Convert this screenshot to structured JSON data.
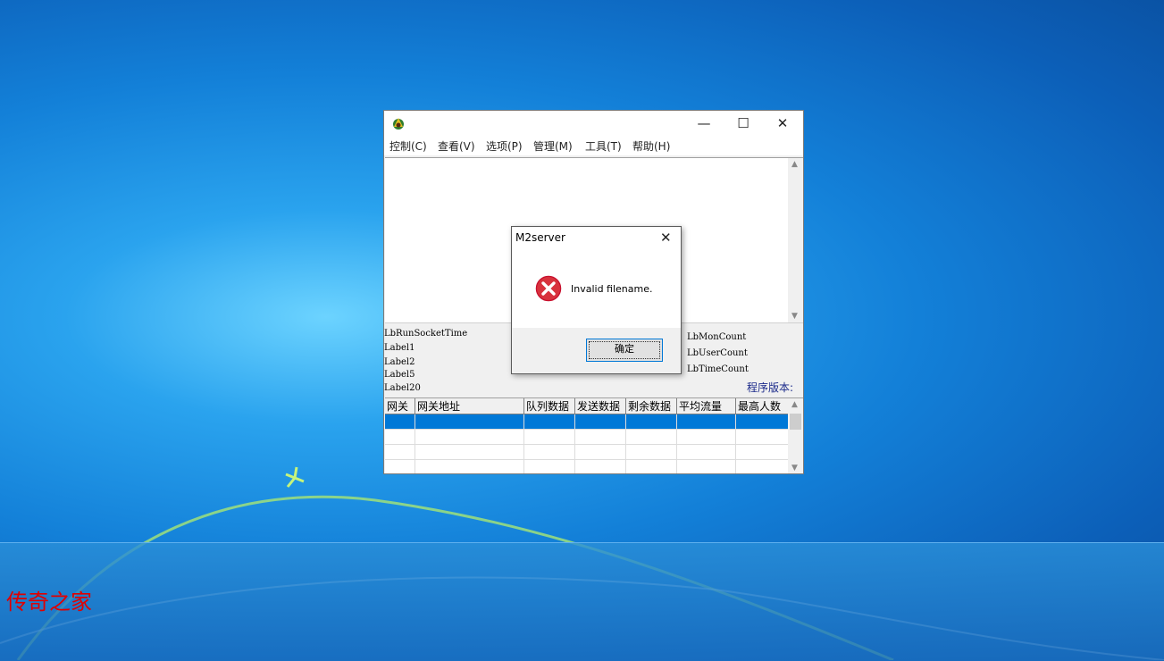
{
  "brand_text": "传奇之家",
  "app": {
    "title": "",
    "icon": "app-icon",
    "window_controls": {
      "minimize": "—",
      "maximize": "☐",
      "close": "✕"
    },
    "menu": [
      {
        "label": "控制(C)"
      },
      {
        "label": "查看(V)"
      },
      {
        "label": "选项(P)"
      },
      {
        "label": "管理(M)"
      },
      {
        "label": "工具(T)"
      },
      {
        "label": "帮助(H)"
      }
    ],
    "status_labels_left": [
      "LbRunSocketTime",
      "Label1",
      "Label2",
      "Label5",
      "Label20"
    ],
    "status_labels_right": [
      "LbMonCount",
      "LbUserCount",
      "LbTimeCount"
    ],
    "version_label": "程序版本:",
    "grid": {
      "columns": [
        "网关",
        "网关地址",
        "队列数据",
        "发送数据",
        "剩余数据",
        "平均流量",
        "最高人数"
      ],
      "selected_row": 0
    }
  },
  "dialog": {
    "title": "M2server",
    "message": "Invalid filename.",
    "ok_label": "确定",
    "icon": "error-icon"
  },
  "colors": {
    "selection": "#0078d7",
    "version_text": "#1b2a8a",
    "brand": "#e00000"
  }
}
